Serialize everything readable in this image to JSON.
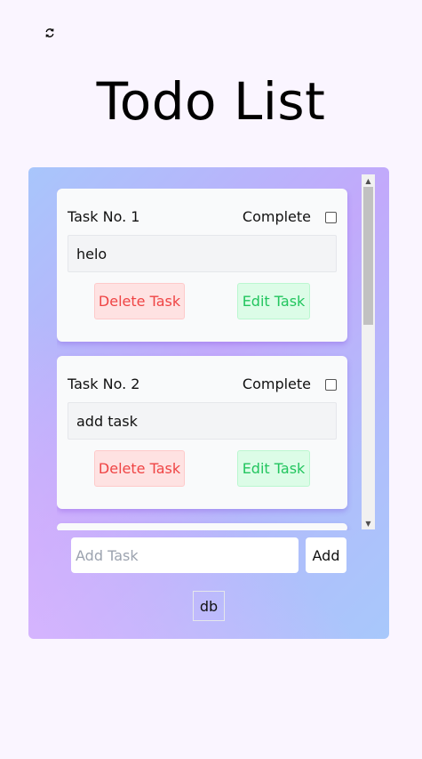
{
  "header": {
    "refresh_icon": "refresh-icon",
    "title": "Todo List"
  },
  "tasks": [
    {
      "number_label": "Task No. 1",
      "complete_label": "Complete",
      "completed": false,
      "text": "helo",
      "delete_label": "Delete Task",
      "edit_label": "Edit Task"
    },
    {
      "number_label": "Task No. 2",
      "complete_label": "Complete",
      "completed": false,
      "text": "add task",
      "delete_label": "Delete Task",
      "edit_label": "Edit Task"
    }
  ],
  "add_form": {
    "placeholder": "Add Task",
    "value": "",
    "add_label": "Add"
  },
  "db_button_label": "db",
  "colors": {
    "page_background": "#faf5ff",
    "delete_bg": "#fee2e2",
    "delete_text": "#ef4444",
    "edit_bg": "#dcfce7",
    "edit_text": "#22c55e"
  }
}
